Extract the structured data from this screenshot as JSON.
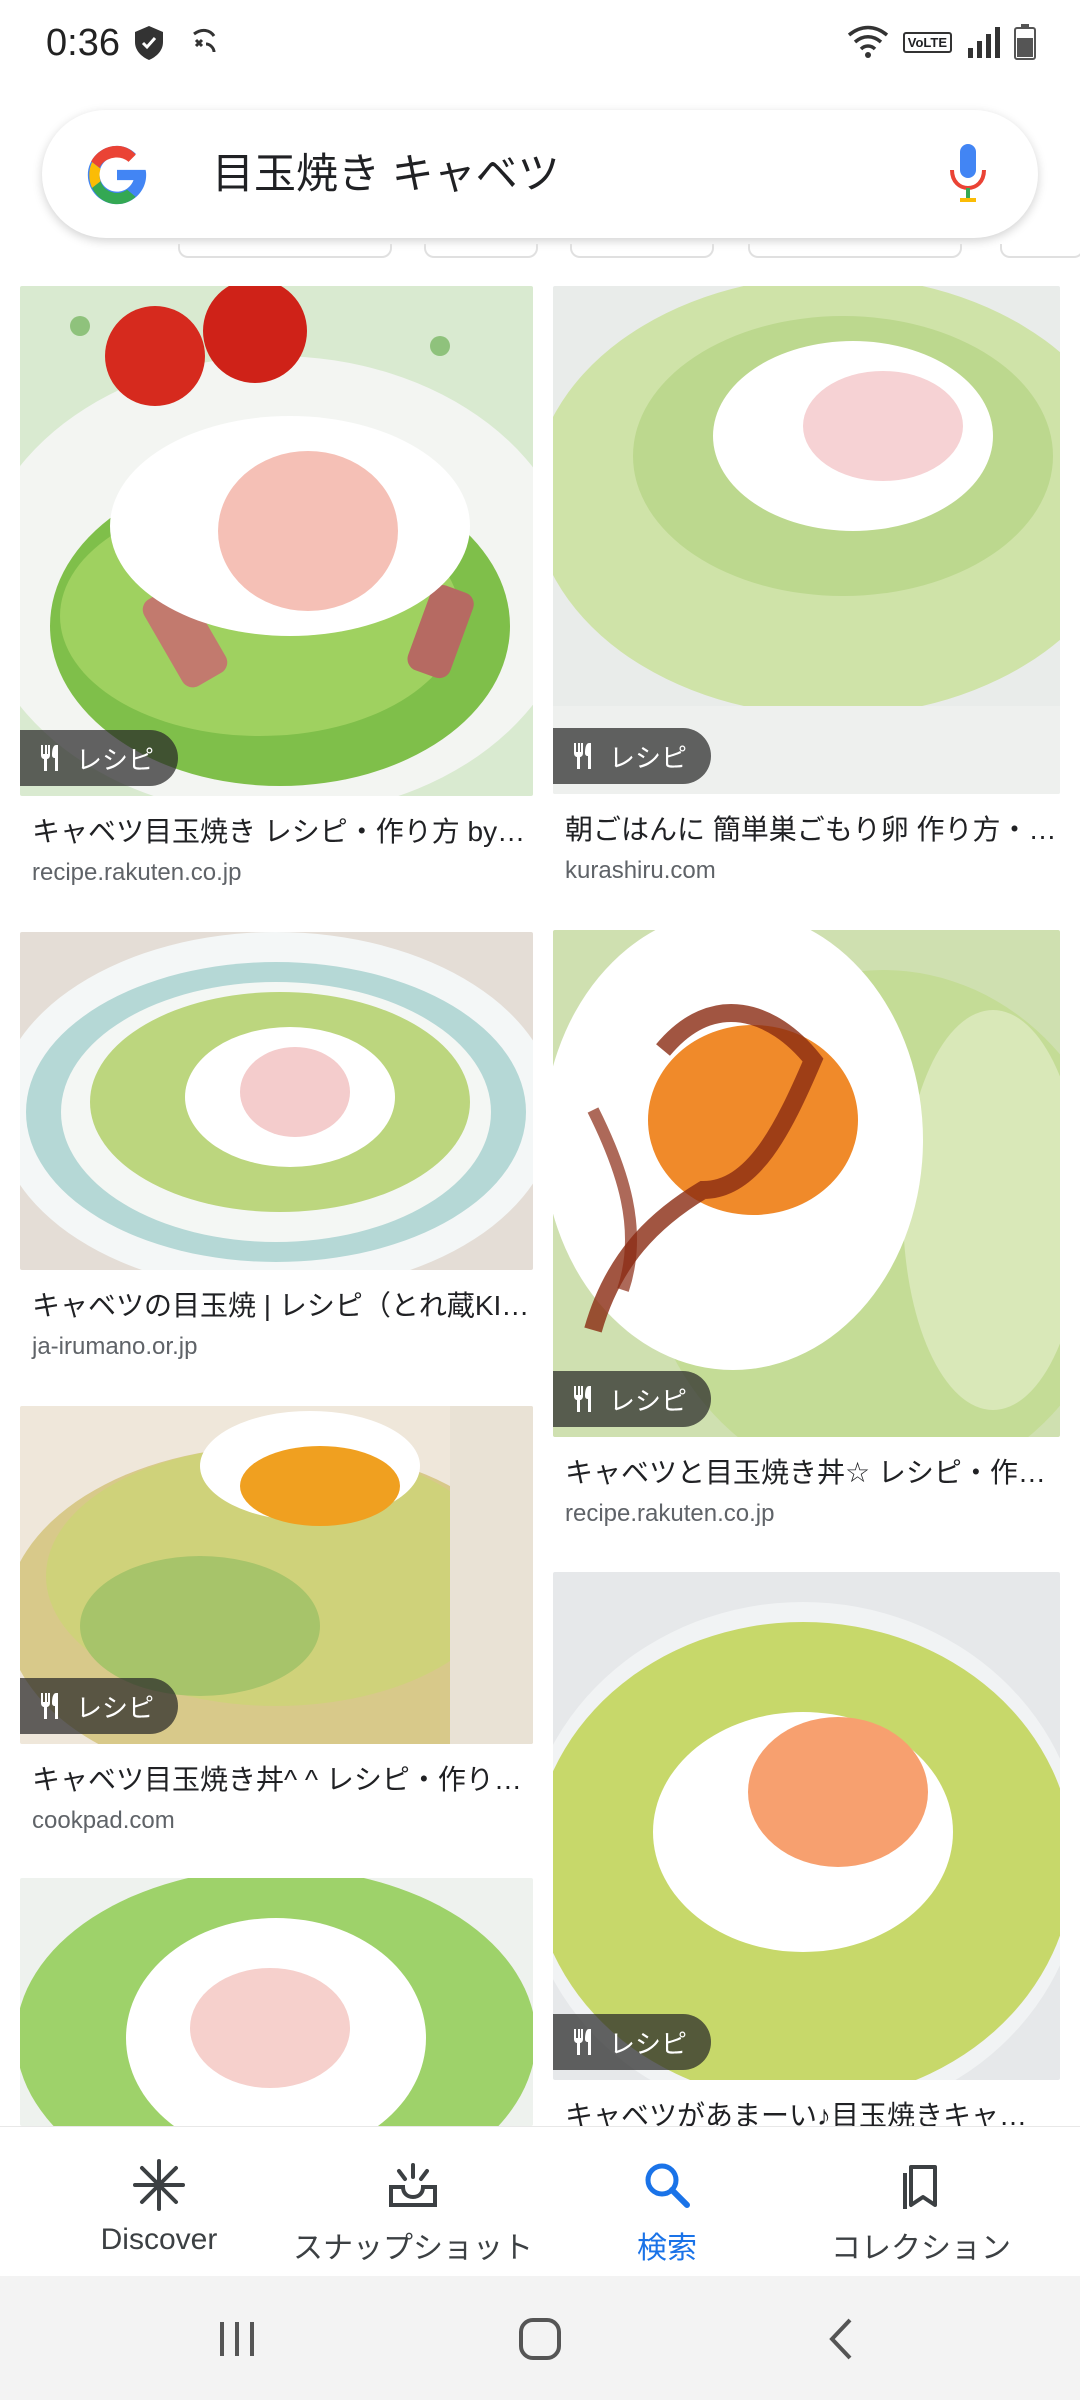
{
  "status_bar": {
    "time": "0:36",
    "volte": "VoLTE"
  },
  "search": {
    "query": "目玉焼き キャベツ"
  },
  "results": [
    {
      "title": "キャベツ目玉焼き レシピ・作り方 by…",
      "source": "recipe.rakuten.co.jp",
      "badge": "レシピ"
    },
    {
      "title": "朝ごはんに 簡単巣ごもり卵 作り方・…",
      "source": "kurashiru.com",
      "badge": "レシピ"
    },
    {
      "title": "キャベツの目玉焼 | レシピ（とれ蔵KI…",
      "source": "ja-irumano.or.jp",
      "badge": ""
    },
    {
      "title": "キャベツと目玉焼き丼☆ レシピ・作…",
      "source": "recipe.rakuten.co.jp",
      "badge": "レシピ"
    },
    {
      "title": "キャベツ目玉焼き丼^ ^ レシピ・作り…",
      "source": "cookpad.com",
      "badge": "レシピ"
    },
    {
      "title": "キャベツがあまーい♪目玉焼きキャ…",
      "source": "",
      "badge": "レシピ"
    },
    {
      "title": "",
      "source": "",
      "badge": ""
    }
  ],
  "bottom_nav": [
    {
      "label": "Discover",
      "icon": "asterisk-icon"
    },
    {
      "label": "スナップショット",
      "icon": "snapshot-icon"
    },
    {
      "label": "検索",
      "icon": "search-icon",
      "active": true
    },
    {
      "label": "コレクション",
      "icon": "bookmark-icon"
    }
  ],
  "colors": {
    "accent": "#1a73e8",
    "badge_bg": "#2a2a2a"
  }
}
